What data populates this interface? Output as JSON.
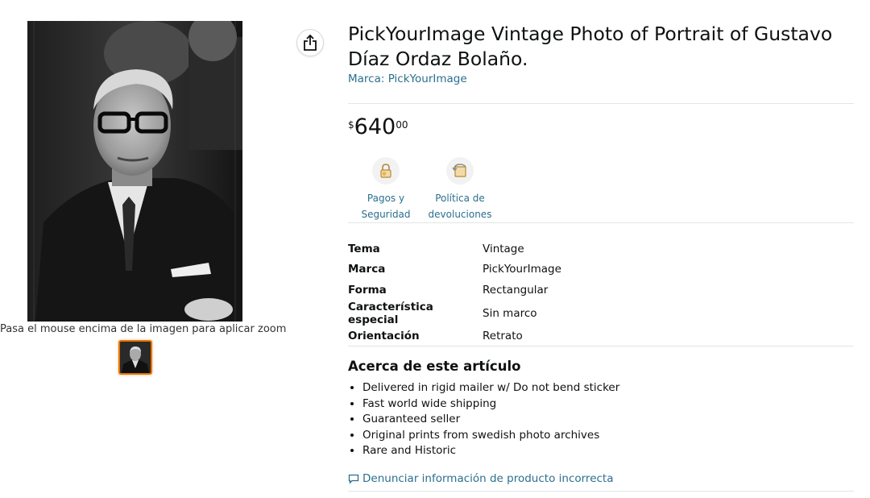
{
  "product": {
    "title": "PickYourImage Vintage Photo of Portrait of Gustavo Díaz Ordaz Bolaño.",
    "brand_link": "Marca: PickYourImage"
  },
  "gallery": {
    "zoom_hint": "Pasa el mouse encima de la imagen para aplicar zoom"
  },
  "price": {
    "symbol": "$",
    "whole": "640",
    "fraction": "00"
  },
  "features": [
    {
      "icon": "secure-payment-lock-icon",
      "label_line1": "Pagos y",
      "label_line2": "Seguridad"
    },
    {
      "icon": "returns-policy-icon",
      "label_line1": "Política de",
      "label_line2": "devoluciones"
    }
  ],
  "specs": [
    {
      "key": "Tema",
      "value": "Vintage"
    },
    {
      "key": "Marca",
      "value": "PickYourImage"
    },
    {
      "key": "Forma",
      "value": "Rectangular"
    },
    {
      "key": "Característica especial",
      "value": "Sin marco"
    },
    {
      "key": "Orientación",
      "value": "Retrato"
    }
  ],
  "about": {
    "heading": "Acerca de este artículo",
    "bullets": [
      "Delivered in rigid mailer w/ Do not bend sticker",
      "Fast world wide shipping",
      "Guaranteed seller",
      "Original prints from swedish photo archives",
      "Rare and Historic"
    ]
  },
  "report_link": "Denunciar información de producto incorrecta",
  "colors": {
    "link": "#2a6f8f",
    "text": "#0f1111",
    "thumb_border": "#e77600",
    "divider": "#e3e6e6"
  }
}
